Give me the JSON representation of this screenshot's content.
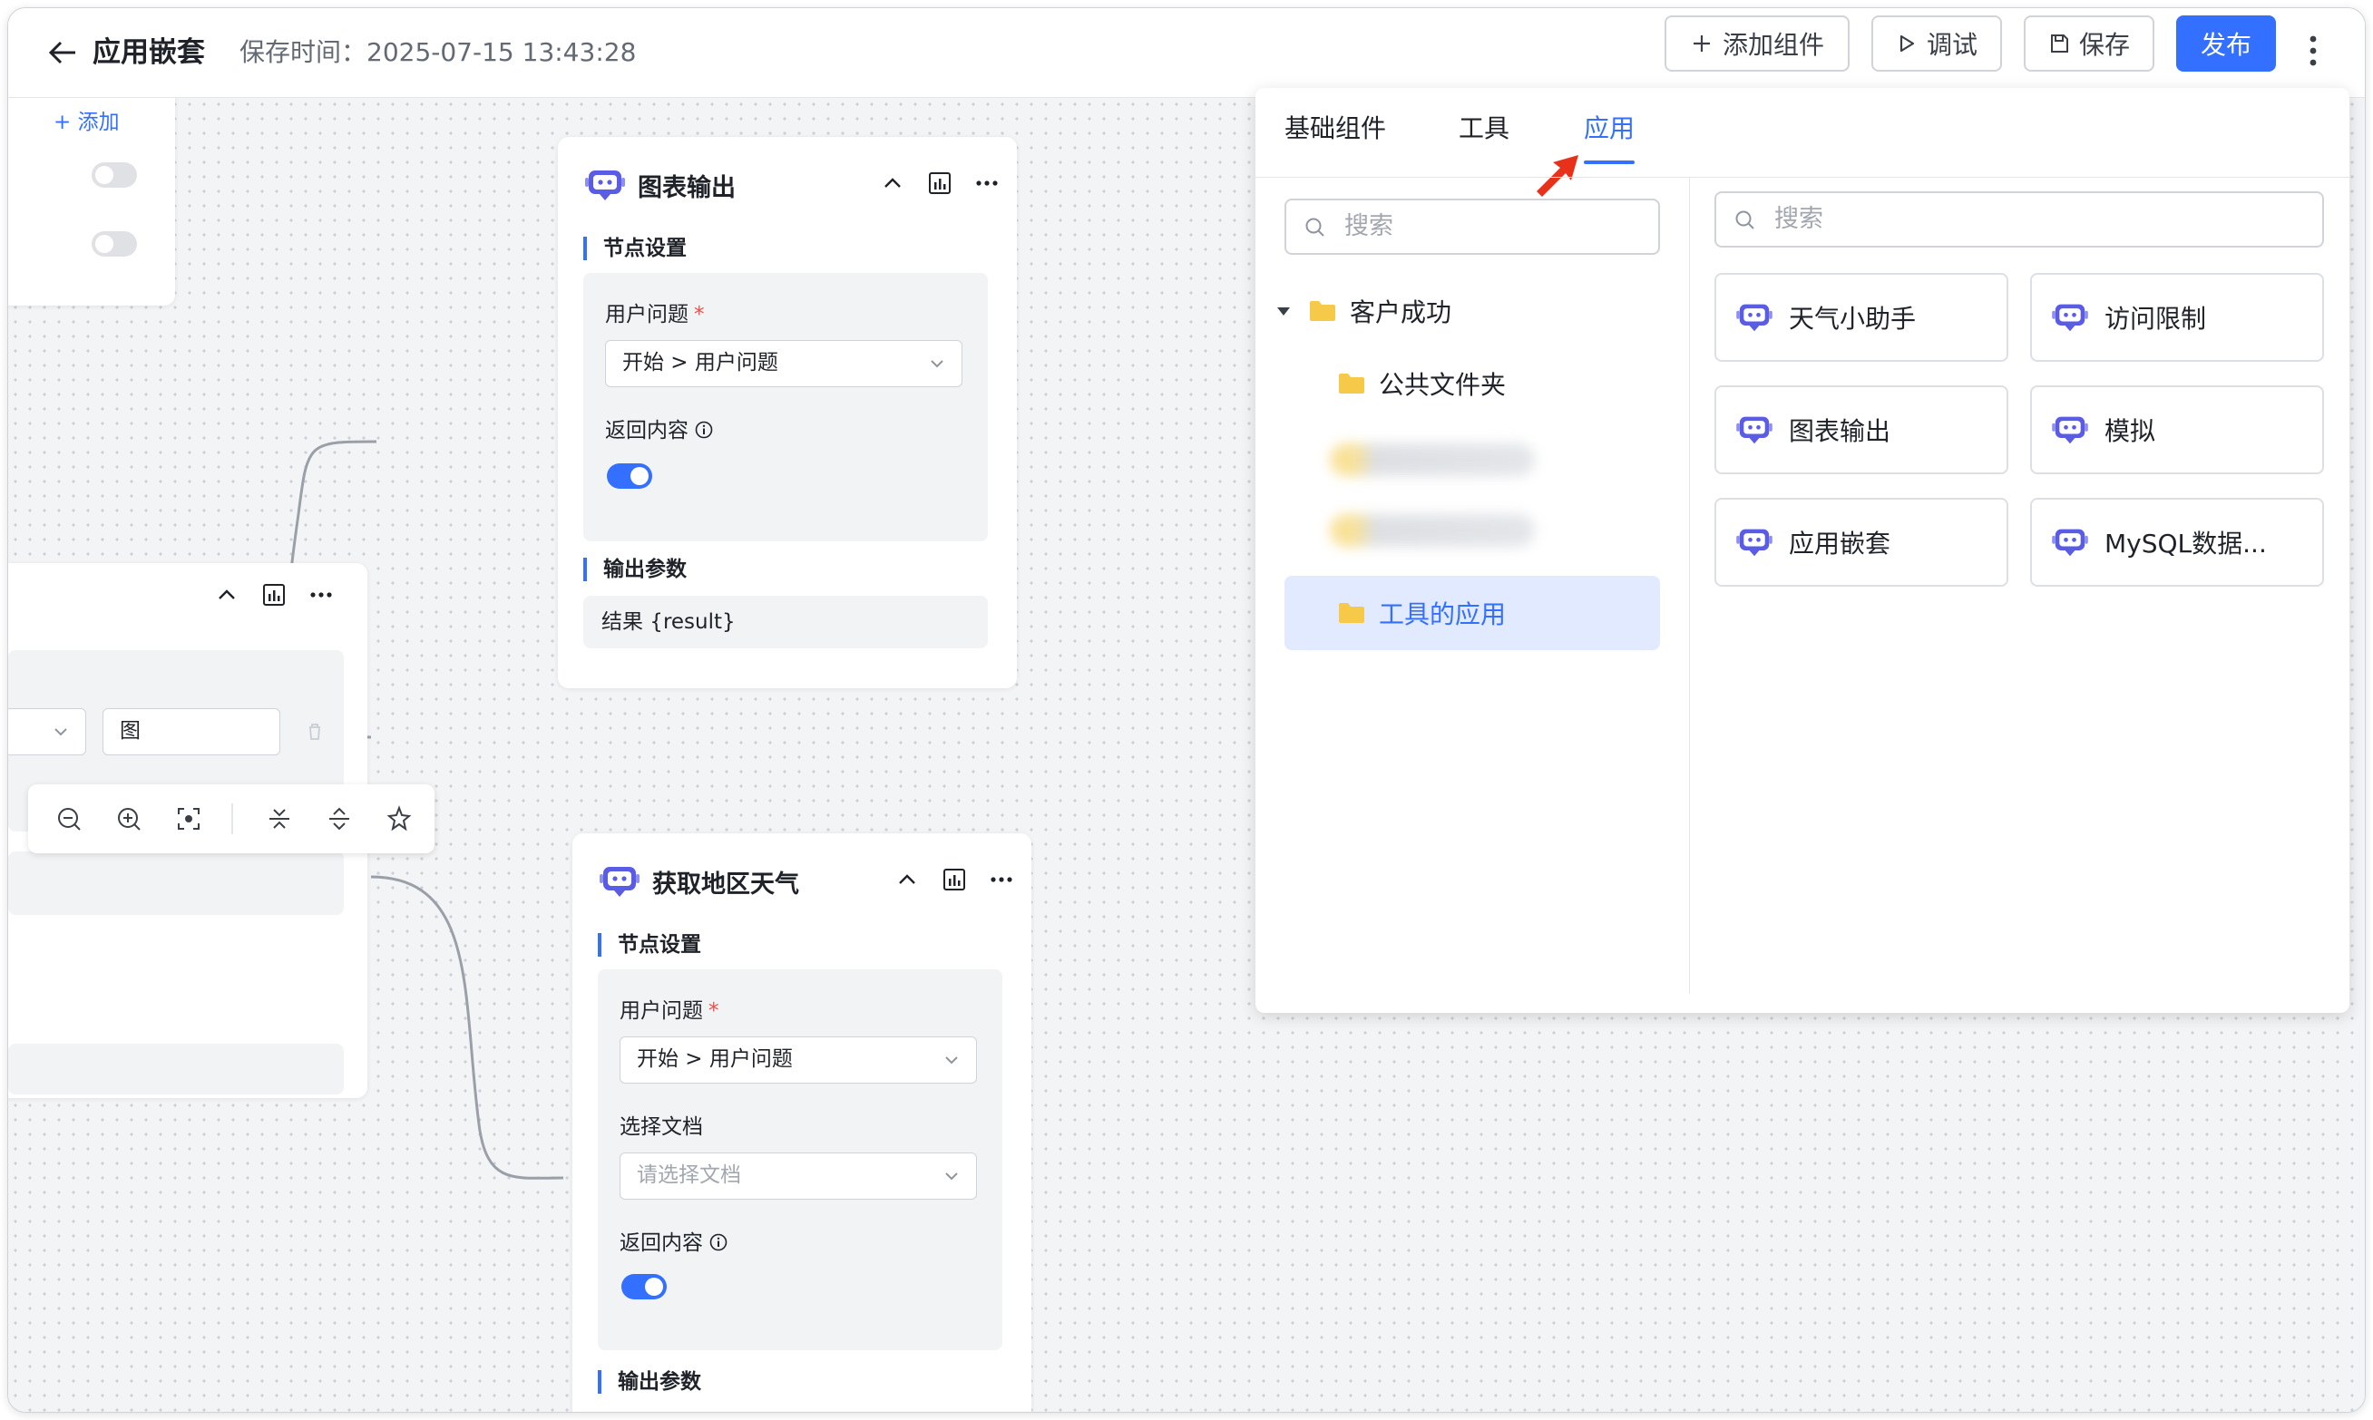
{
  "header": {
    "title": "应用嵌套",
    "save_time": "保存时间：2025-07-15 13:43:28",
    "add_component": "添加组件",
    "debug": "调试",
    "save": "保存",
    "publish": "发布"
  },
  "left_card": {
    "add_label": "+ 添加"
  },
  "left_node": {
    "input_value": "图"
  },
  "node_chart": {
    "title": "图表输出",
    "section_settings": "节点设置",
    "user_question_label": "用户问题",
    "required_mark": "*",
    "user_question_value": "开始 > 用户问题",
    "return_content_label": "返回内容",
    "section_output": "输出参数",
    "output_value": "结果 {result}"
  },
  "node_weather": {
    "title": "获取地区天气",
    "section_settings": "节点设置",
    "user_question_label": "用户问题",
    "required_mark": "*",
    "user_question_value": "开始 > 用户问题",
    "select_doc_label": "选择文档",
    "select_doc_placeholder": "请选择文档",
    "return_content_label": "返回内容",
    "section_output": "输出参数"
  },
  "popup": {
    "tabs": [
      "基础组件",
      "工具",
      "应用"
    ],
    "active_tab": "应用",
    "left_search_placeholder": "搜索",
    "right_search_placeholder": "搜索",
    "tree": {
      "root": "客户成功",
      "child_public": "公共文件夹",
      "child_selected": "工具的应用"
    },
    "apps": [
      "天气小助手",
      "访问限制",
      "图表输出",
      "模拟",
      "应用嵌套",
      "MySQL数据..."
    ]
  },
  "colors": {
    "accent": "#3370ff",
    "arrow": "#e8311a",
    "folder": "#f7c948",
    "bot": "#5b5ce6"
  }
}
